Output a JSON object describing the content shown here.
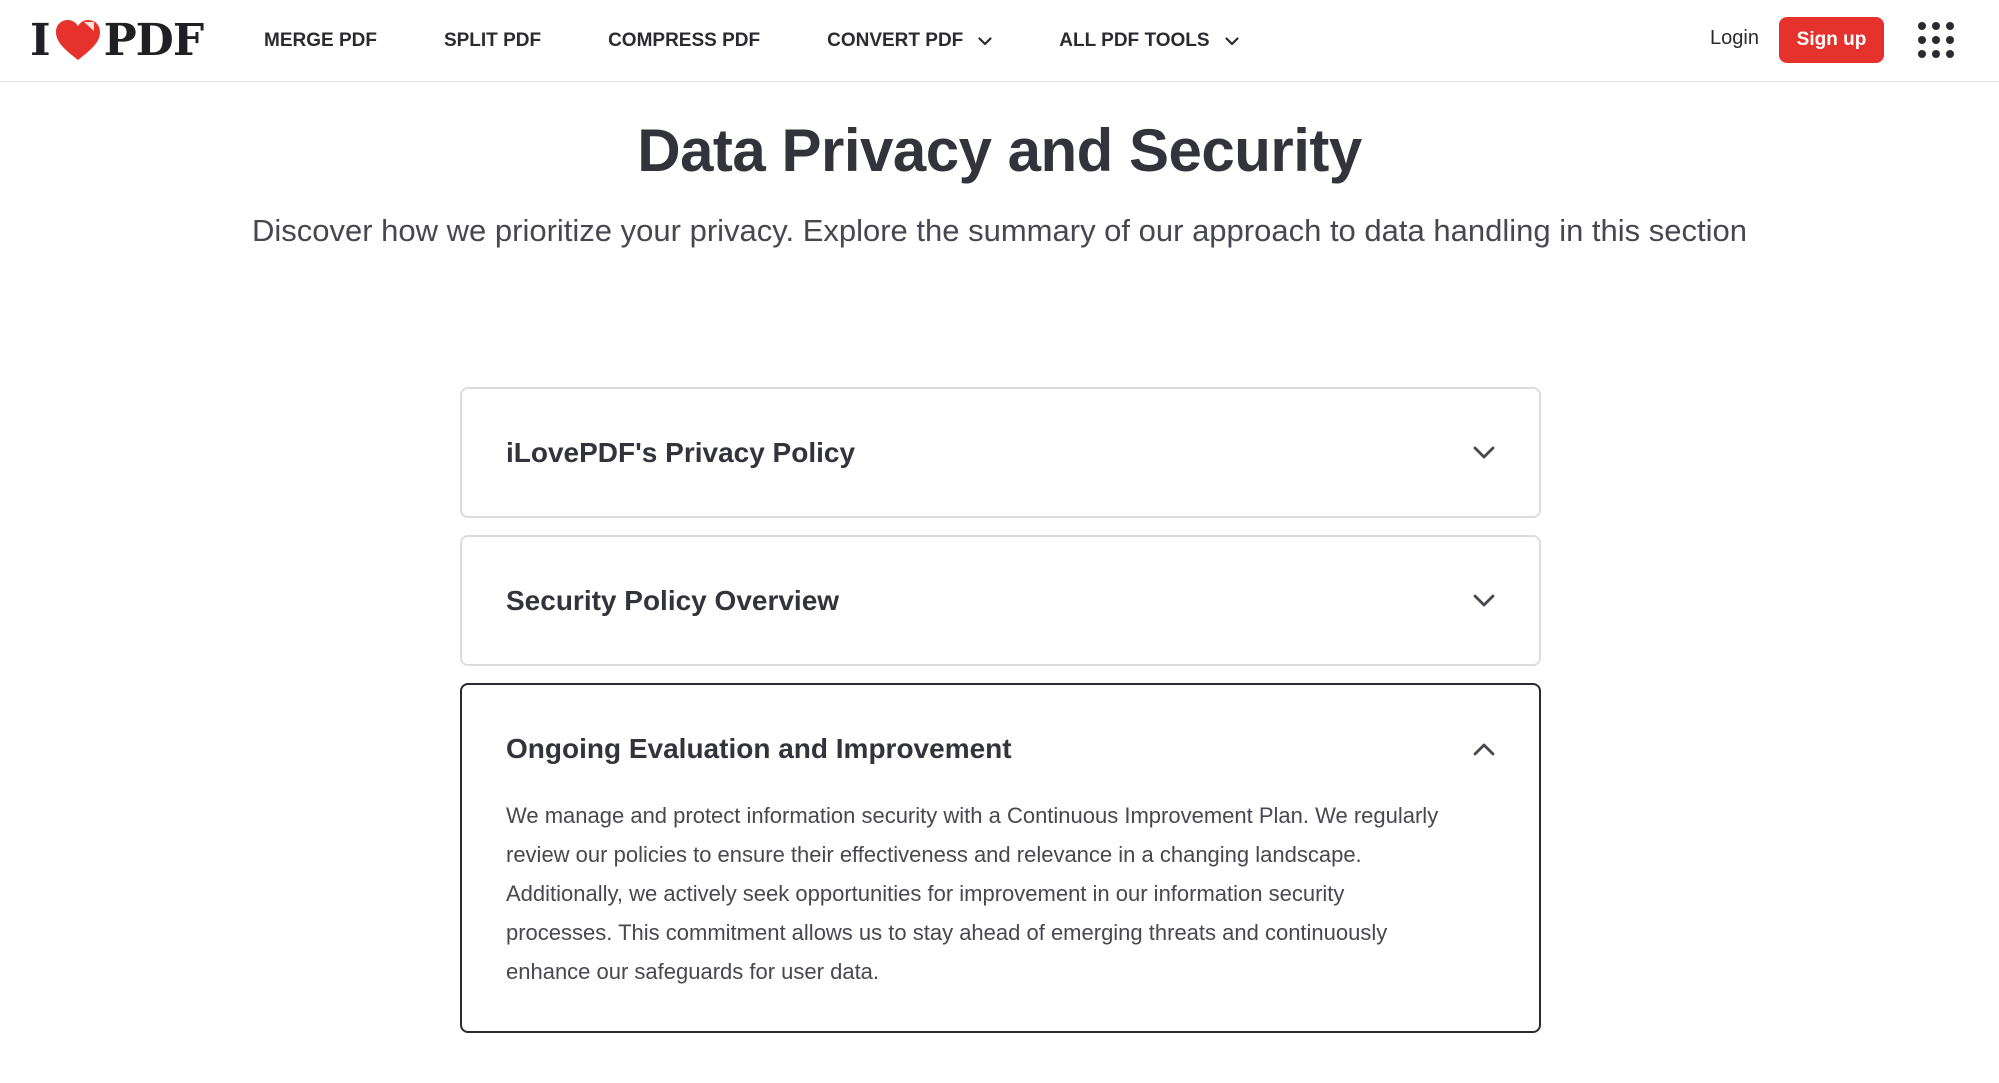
{
  "brand": {
    "logo_left": "I",
    "logo_right": "PDF",
    "accent_color": "#e5322d"
  },
  "nav": {
    "items": [
      {
        "label": "MERGE PDF",
        "has_dropdown": false
      },
      {
        "label": "SPLIT PDF",
        "has_dropdown": false
      },
      {
        "label": "COMPRESS PDF",
        "has_dropdown": false
      },
      {
        "label": "CONVERT PDF",
        "has_dropdown": true
      },
      {
        "label": "ALL PDF TOOLS",
        "has_dropdown": true
      }
    ],
    "login_label": "Login",
    "signup_label": "Sign up",
    "apps_icon": "grid-dots-icon"
  },
  "hero": {
    "title": "Data Privacy and Security",
    "subtitle": "Discover how we prioritize your privacy. Explore the summary of our approach to data handling in this section"
  },
  "accordion": {
    "items": [
      {
        "title": "iLovePDF's Privacy Policy",
        "expanded": false
      },
      {
        "title": "Security Policy Overview",
        "expanded": false
      },
      {
        "title": "Ongoing Evaluation and Improvement",
        "expanded": true,
        "body": "We manage and protect information security with a Continuous Improvement Plan. We regularly review our policies to ensure their effectiveness and relevance in a changing landscape. Additionally, we actively seek opportunities for improvement in our information security processes. This commitment allows us to stay ahead of emerging threats and continuously enhance our safeguards for user data."
      }
    ]
  }
}
